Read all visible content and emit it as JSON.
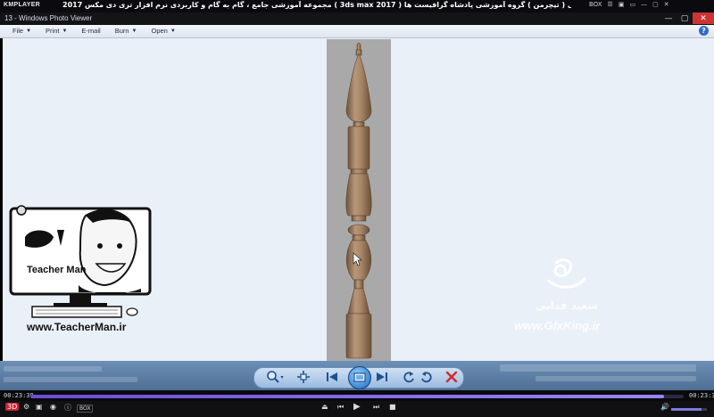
{
  "km_player": {
    "logo": "KMPLAYER",
    "title": "مجموعه آموزشی جامع ، گام به گام و کاربردی نرم افزار تری دی مکس 2017 ( 3ds max 2017 )  مدرس : سعید فدایی ( تیچرمن ) گروه آموزشی پادشاه گرافیست ها",
    "title_buttons": [
      "BOX",
      "☰",
      "▣",
      "▭",
      "—",
      "▢",
      "✕"
    ],
    "time_elapsed": "00:23:38",
    "time_total": "00:23:36",
    "progress_fraction": 0.97,
    "volume_fraction": 0.85,
    "bottom_left_badge": "3D",
    "bottom_badge": "BOX"
  },
  "photo_viewer": {
    "window_title": "13 - Windows Photo Viewer",
    "menu": [
      {
        "label": "File",
        "arrow": "▼"
      },
      {
        "label": "Print",
        "arrow": "▼"
      },
      {
        "label": "E-mail",
        "arrow": ""
      },
      {
        "label": "Burn",
        "arrow": "▼"
      },
      {
        "label": "Open",
        "arrow": "▼"
      }
    ],
    "help": "?",
    "win_buttons": {
      "minimize": "—",
      "maximize": "▢",
      "close": "✕"
    }
  },
  "overlay": {
    "teacher_logo_text": "Teacher Man",
    "teacher_url": "www.TeacherMan.ir",
    "gfx_name": "سعید فدایی",
    "gfx_url": "www.GfxKing.ir"
  },
  "colors": {
    "viewer_bg": "#eaf0f7",
    "image_bg": "#a9a9a9",
    "wood": "#a78666",
    "wood_dark": "#7a5d43"
  }
}
